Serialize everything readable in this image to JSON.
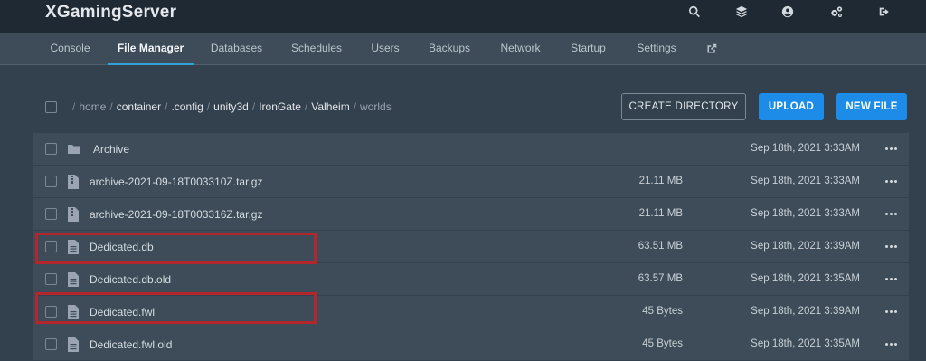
{
  "app": {
    "title": "XGamingServer"
  },
  "top_icons": [
    {
      "name": "search-icon"
    },
    {
      "name": "layers-icon"
    },
    {
      "name": "user-icon"
    },
    {
      "name": "cogs-icon"
    },
    {
      "name": "sign-out-icon"
    }
  ],
  "nav": {
    "tabs": [
      {
        "label": "Console"
      },
      {
        "label": "File Manager",
        "active": true
      },
      {
        "label": "Databases"
      },
      {
        "label": "Schedules"
      },
      {
        "label": "Users"
      },
      {
        "label": "Backups"
      },
      {
        "label": "Network"
      },
      {
        "label": "Startup"
      },
      {
        "label": "Settings"
      }
    ],
    "external_icon": "external-link-icon"
  },
  "breadcrumb": {
    "segments": [
      "home",
      "container",
      ".config",
      "unity3d",
      "IronGate",
      "Valheim",
      "worlds"
    ]
  },
  "buttons": {
    "create_directory": "CREATE DIRECTORY",
    "upload": "UPLOAD",
    "new_file": "NEW FILE"
  },
  "files": [
    {
      "name": "Archive",
      "type": "folder",
      "size": "",
      "date": "Sep 18th, 2021 3:33AM",
      "highlighted": false
    },
    {
      "name": "archive-2021-09-18T003310Z.tar.gz",
      "type": "archive",
      "size": "21.11 MB",
      "date": "Sep 18th, 2021 3:33AM",
      "highlighted": false
    },
    {
      "name": "archive-2021-09-18T003316Z.tar.gz",
      "type": "archive",
      "size": "21.11 MB",
      "date": "Sep 18th, 2021 3:33AM",
      "highlighted": false
    },
    {
      "name": "Dedicated.db",
      "type": "file",
      "size": "63.51 MB",
      "date": "Sep 18th, 2021 3:39AM",
      "highlighted": true
    },
    {
      "name": "Dedicated.db.old",
      "type": "file",
      "size": "63.57 MB",
      "date": "Sep 18th, 2021 3:35AM",
      "highlighted": false
    },
    {
      "name": "Dedicated.fwl",
      "type": "file",
      "size": "45 Bytes",
      "date": "Sep 18th, 2021 3:39AM",
      "highlighted": true
    },
    {
      "name": "Dedicated.fwl.old",
      "type": "file",
      "size": "45 Bytes",
      "date": "Sep 18th, 2021 3:35AM",
      "highlighted": false
    }
  ],
  "colors": {
    "topbar": "#1f2933",
    "nav": "#3e4c59",
    "background": "#33404d",
    "accent": "#2ea3d6",
    "primary_button": "#1d8ce8",
    "highlight_border": "#b3262b"
  }
}
